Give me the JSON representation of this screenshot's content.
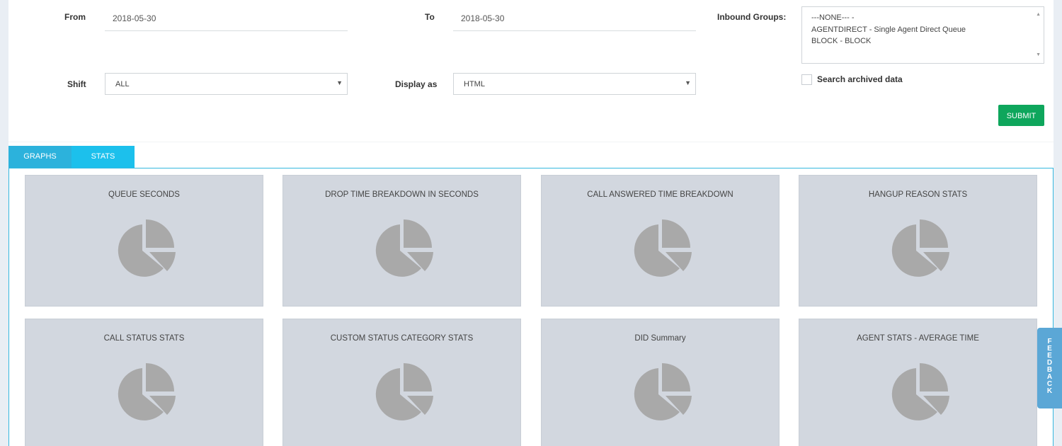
{
  "filters": {
    "from_label": "From",
    "from_value": "2018-05-30",
    "to_label": "To",
    "to_value": "2018-05-30",
    "inbound_label": "Inbound Groups:",
    "inbound_options": [
      "---NONE--- -",
      "AGENTDIRECT - Single Agent Direct Queue",
      "BLOCK - BLOCK"
    ],
    "shift_label": "Shift",
    "shift_value": "ALL",
    "display_label": "Display as",
    "display_value": "HTML",
    "archive_label": "Search archived data",
    "archive_checked": false,
    "submit_label": "SUBMIT"
  },
  "tabs": [
    {
      "label": "GRAPHS",
      "active": false
    },
    {
      "label": "STATS",
      "active": true
    }
  ],
  "cards": [
    {
      "title": "QUEUE SECONDS",
      "icon": "pie-chart-icon"
    },
    {
      "title": "DROP TIME BREAKDOWN IN SECONDS",
      "icon": "pie-chart-icon"
    },
    {
      "title": "CALL ANSWERED TIME BREAKDOWN",
      "icon": "pie-chart-icon"
    },
    {
      "title": "HANGUP REASON STATS",
      "icon": "pie-chart-icon"
    },
    {
      "title": "CALL STATUS STATS",
      "icon": "pie-chart-icon"
    },
    {
      "title": "CUSTOM STATUS CATEGORY STATS",
      "icon": "pie-chart-icon"
    },
    {
      "title": "DID Summary",
      "icon": "pie-chart-icon"
    },
    {
      "title": "AGENT STATS - AVERAGE TIME",
      "icon": "pie-chart-icon"
    }
  ],
  "feedback": {
    "label": "FEEDBACK"
  },
  "colors": {
    "tab_graphs": "#2cb2dc",
    "tab_stats": "#1cc0ec",
    "submit": "#0ea65c",
    "card_bg": "#d2d7df",
    "pie_icon": "#a9a9a9",
    "feedback": "#5ba7d6"
  }
}
